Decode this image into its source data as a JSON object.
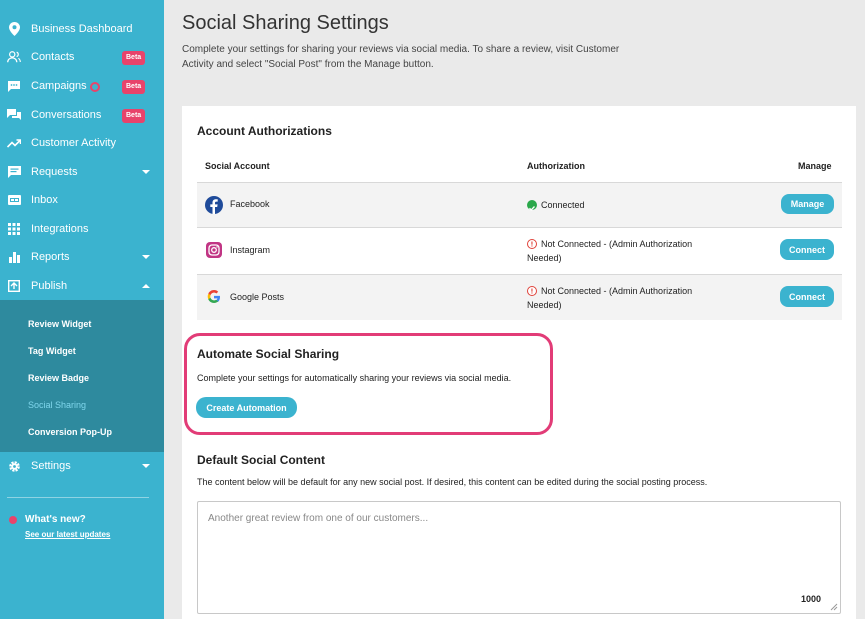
{
  "sidebar": {
    "items": [
      {
        "label": "Business Dashboard",
        "icon": "location-pin-icon"
      },
      {
        "label": "Contacts",
        "icon": "contacts-icon",
        "badge": "Beta"
      },
      {
        "label": "Campaigns",
        "icon": "chat-bubble-icon",
        "badge": "Beta"
      },
      {
        "label": "Conversations",
        "icon": "conversations-icon",
        "badge": "Beta"
      },
      {
        "label": "Customer Activity",
        "icon": "trend-icon"
      },
      {
        "label": "Requests",
        "icon": "requests-icon"
      },
      {
        "label": "Inbox",
        "icon": "inbox-icon"
      },
      {
        "label": "Integrations",
        "icon": "grid-icon"
      },
      {
        "label": "Reports",
        "icon": "bar-chart-icon"
      },
      {
        "label": "Publish",
        "icon": "publish-icon"
      }
    ],
    "publish_sub": [
      "Review Widget",
      "Tag Widget",
      "Review Badge",
      "Social Sharing",
      "Conversion Pop-Up"
    ],
    "settings_label": "Settings",
    "whats_new_title": "What's new?",
    "whats_new_link": "See our latest updates"
  },
  "main": {
    "title": "Social Sharing Settings",
    "description": "Complete your settings for sharing your reviews via social media. To share a review, visit Customer Activity and select \"Social Post\" from the Manage button.",
    "account_auth": {
      "title": "Account Authorizations",
      "headers": [
        "Social Account",
        "Authorization",
        "Manage"
      ],
      "rows": [
        {
          "account": "Facebook",
          "status": "Connected",
          "status_type": "ok",
          "action": "Manage"
        },
        {
          "account": "Instagram",
          "status": "Not Connected - (Admin Authorization Needed)",
          "status_type": "error",
          "action": "Connect"
        },
        {
          "account": "Google Posts",
          "status": "Not Connected - (Admin Authorization Needed)",
          "status_type": "error",
          "action": "Connect"
        }
      ]
    },
    "automate": {
      "title": "Automate Social Sharing",
      "text": "Complete your settings for automatically sharing your reviews via social media.",
      "button": "Create Automation"
    },
    "default_content": {
      "title": "Default Social Content",
      "text": "The content below will be default for any new social post. If desired, this content can be edited during the social posting process.",
      "placeholder": "Another great review from one of our customers...",
      "char_count": "1000"
    }
  },
  "colors": {
    "accent": "#3bb3cf",
    "sidebar_sub": "#2e8a9e",
    "badge": "#e8436b",
    "highlight": "#e23c77",
    "ok": "#2aa84a",
    "error": "#e0423a"
  }
}
